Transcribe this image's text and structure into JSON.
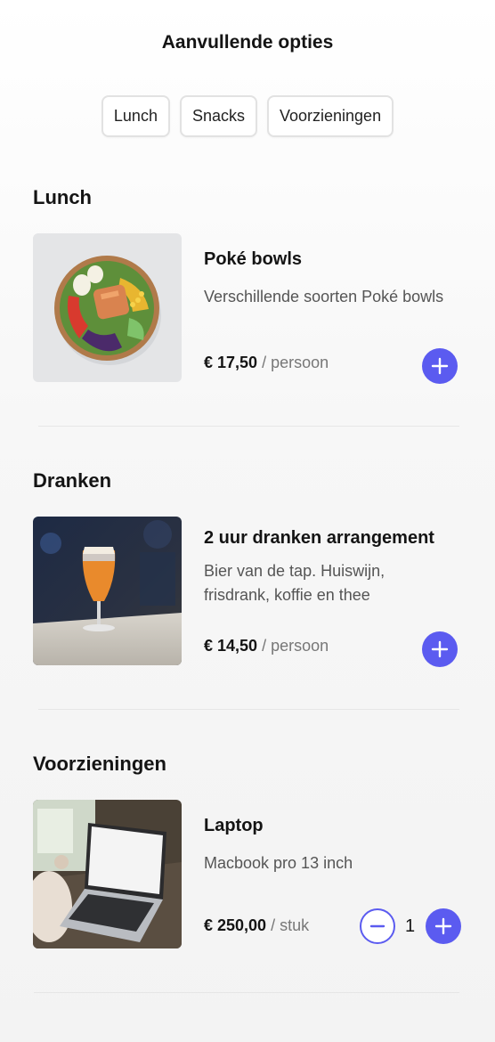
{
  "header": {
    "title": "Aanvullende opties"
  },
  "tabs": [
    {
      "label": "Lunch"
    },
    {
      "label": "Snacks"
    },
    {
      "label": "Voorzieningen"
    }
  ],
  "sections": [
    {
      "title": "Lunch",
      "item": {
        "image": "poke-bowl-photo",
        "name": "Poké bowls",
        "description": "Verschillende soorten Poké bowls",
        "price": "€ 17,50",
        "unit": "/ persoon"
      }
    },
    {
      "title": "Dranken",
      "item": {
        "image": "beer-glass-photo",
        "name": "2 uur dranken arrangement",
        "description": "Bier van de tap. Huiswijn, frisdrank, koffie en thee",
        "price": "€ 14,50",
        "unit": "/ persoon"
      }
    },
    {
      "title": "Voorzieningen",
      "item": {
        "image": "laptop-photo",
        "name": "Laptop",
        "description": "Macbook pro 13 inch",
        "price": "€ 250,00",
        "unit": "/ stuk",
        "quantity": "1"
      }
    }
  ],
  "colors": {
    "accent": "#5b5bf0",
    "divider": "#e6e6e6"
  },
  "icons": {
    "add": "plus-icon",
    "remove": "minus-icon"
  }
}
